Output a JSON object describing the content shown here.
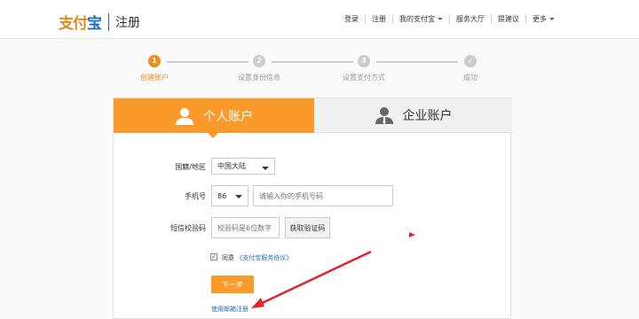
{
  "header": {
    "logo_text_a": "支付",
    "logo_text_b": "宝",
    "page_title": "注册",
    "nav": {
      "login": "登录",
      "register": "注册",
      "my_alipay": "我的支付宝",
      "service_hall": "服务大厅",
      "suggest": "提建议",
      "more": "更多"
    }
  },
  "steps": [
    {
      "num": "1",
      "label": "创建账户",
      "active": true
    },
    {
      "num": "2",
      "label": "设置身份信息",
      "active": false
    },
    {
      "num": "3",
      "label": "设置支付方式",
      "active": false
    },
    {
      "num": "✓",
      "label": "成功",
      "active": false
    }
  ],
  "tabs": {
    "personal": "个人账户",
    "business": "企业账户"
  },
  "form": {
    "region_label": "国籍/地区",
    "region_value": "中国大陆",
    "phone_label": "手机号",
    "phone_code": "86",
    "phone_placeholder": "请输入你的手机号码",
    "sms_label": "短信校验码",
    "sms_placeholder": "校验码是6位数字",
    "get_code_button": "获取验证码",
    "agree_text": "同意",
    "agreement_link": "《支付宝服务协议》",
    "agree_checked": "✓",
    "next_button": "下一步",
    "email_register_link": "使用邮箱注册"
  },
  "colors": {
    "accent": "#f99a2b",
    "link": "#1e6fc3",
    "annotation": "#e0232b"
  }
}
